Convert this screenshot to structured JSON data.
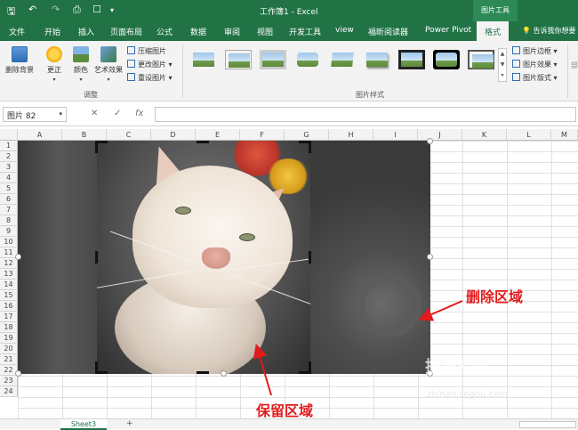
{
  "window": {
    "title": "工作簿1 - Excel",
    "context_tab": "图片工具"
  },
  "tabs": [
    {
      "label": "文件"
    },
    {
      "label": "开始"
    },
    {
      "label": "插入"
    },
    {
      "label": "页面布局"
    },
    {
      "label": "公式"
    },
    {
      "label": "数据"
    },
    {
      "label": "审阅"
    },
    {
      "label": "视图"
    },
    {
      "label": "开发工具"
    },
    {
      "label": "view"
    },
    {
      "label": "福昕阅读器"
    },
    {
      "label": "Power Pivot"
    },
    {
      "label": "格式"
    }
  ],
  "tell_me": "告诉我你想要",
  "ribbon": {
    "remove_bg": "删除背景",
    "corrections": "更正",
    "color": "颜色",
    "artistic": "艺术效果",
    "compress": "压缩图片",
    "change": "更改图片",
    "reset": "重设图片",
    "adjust_group": "调整",
    "styles_group": "图片样式",
    "border": "图片边框",
    "effects": "图片效果",
    "layout": "图片版式",
    "partial": "部"
  },
  "formula_bar": {
    "name_box": "图片 82",
    "cancel": "✕",
    "enter": "✓",
    "fx": "fx"
  },
  "columns": [
    "A",
    "B",
    "C",
    "D",
    "E",
    "F",
    "G",
    "H",
    "I",
    "J",
    "K",
    "L",
    "M"
  ],
  "rows": [
    "1",
    "2",
    "3",
    "4",
    "5",
    "6",
    "7",
    "8",
    "9",
    "10",
    "11",
    "12",
    "13",
    "14",
    "15",
    "16",
    "17",
    "18",
    "19",
    "20",
    "21",
    "22",
    "23",
    "24"
  ],
  "annotations": {
    "delete_area": "删除区域",
    "keep_area": "保留区域"
  },
  "watermark": {
    "line1": "搜狗指南",
    "line2": "zhinan.sogou.com"
  },
  "sheets": [
    {
      "name": "Sheet3"
    }
  ],
  "add_sheet": "+",
  "colors": {
    "excel_green": "#217346",
    "annotation_red": "#e21b1b"
  }
}
